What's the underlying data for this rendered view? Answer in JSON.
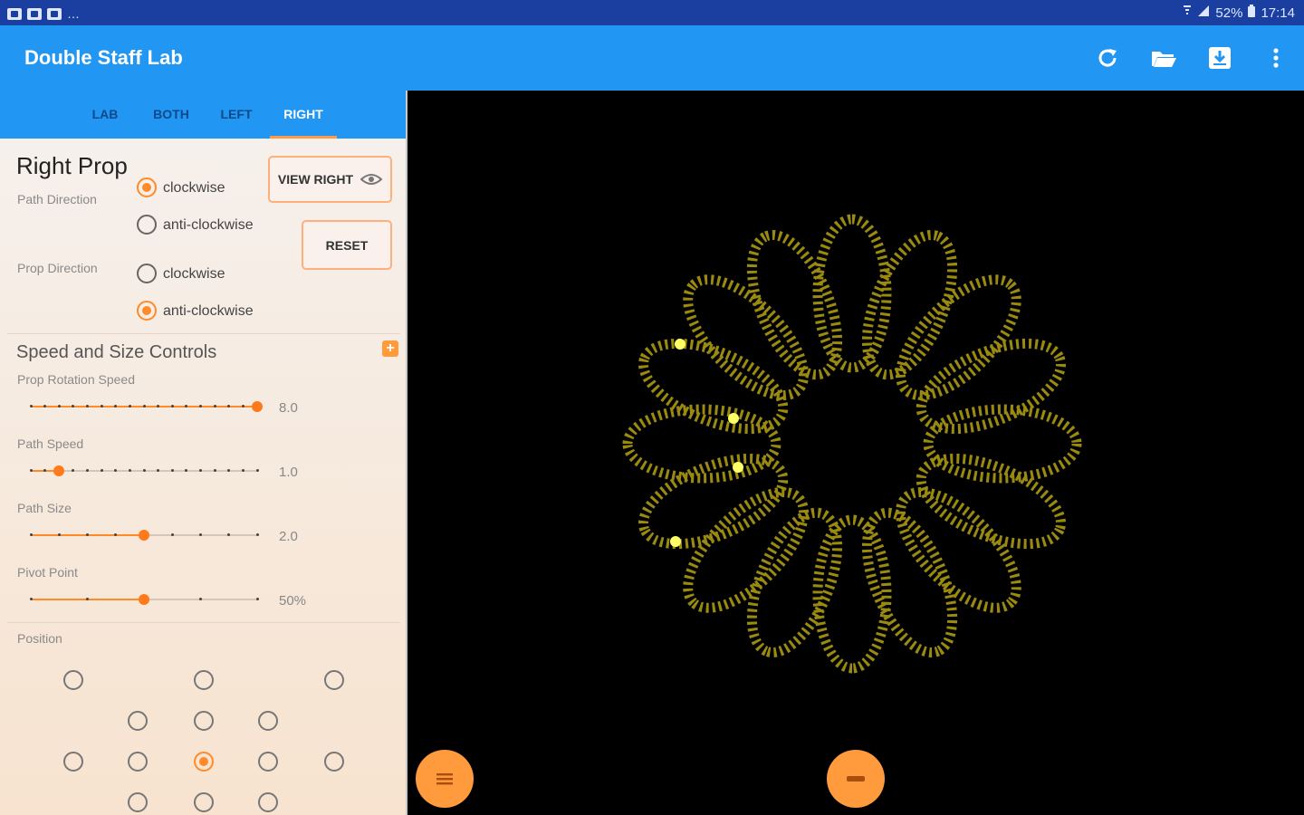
{
  "status_bar": {
    "battery": "52%",
    "time": "17:14"
  },
  "app": {
    "title": "Double Staff Lab"
  },
  "tabs": [
    {
      "label": "LAB"
    },
    {
      "label": "BOTH"
    },
    {
      "label": "LEFT"
    },
    {
      "label": "RIGHT",
      "active": true
    }
  ],
  "prop_panel": {
    "title": "Right Prop",
    "path_direction_label": "Path Direction",
    "path_direction_options": [
      "clockwise",
      "anti-clockwise"
    ],
    "path_direction_selected": "clockwise",
    "prop_direction_label": "Prop Direction",
    "prop_direction_options": [
      "clockwise",
      "anti-clockwise"
    ],
    "prop_direction_selected": "anti-clockwise",
    "view_button": "VIEW RIGHT",
    "reset_button": "RESET"
  },
  "controls": {
    "section_title": "Speed and Size Controls",
    "sliders": [
      {
        "label": "Prop Rotation Speed",
        "value_text": "8.0",
        "fraction": 1.0,
        "ticks": 17
      },
      {
        "label": "Path Speed",
        "value_text": "1.0",
        "fraction": 0.125,
        "ticks": 17
      },
      {
        "label": "Path Size",
        "value_text": "2.0",
        "fraction": 0.5,
        "ticks": 9
      },
      {
        "label": "Pivot Point",
        "value_text": "50%",
        "fraction": 0.5,
        "ticks": 5
      }
    ]
  },
  "position": {
    "label": "Position",
    "selected_row": 2,
    "selected_col": 2
  },
  "visualization": {
    "petal_count": 16,
    "petal_color": "#9a8a10",
    "highlight_color": "#ffff66"
  },
  "colors": {
    "primary": "#2196f3",
    "status_bar": "#1a3fa0",
    "accent": "#ff8a2a"
  },
  "icons": {
    "actions": [
      "refresh-icon",
      "open-folder-icon",
      "save-icon",
      "more-vert-icon"
    ],
    "fab_left": "menu-icon",
    "fab_center": "minus-icon"
  }
}
